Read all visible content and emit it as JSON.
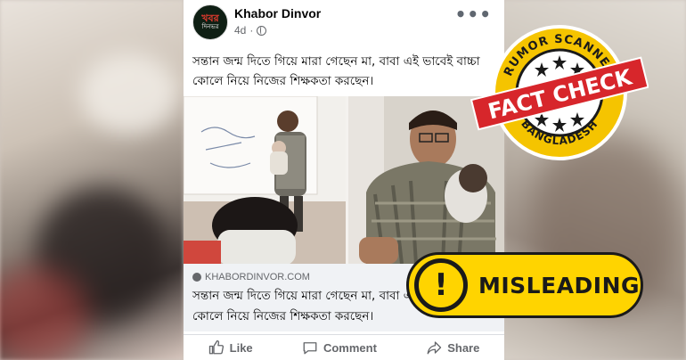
{
  "post": {
    "page_name": "Khabor Dinvor",
    "avatar_line1": "খবর",
    "avatar_line2": "দিনভর",
    "time": "4d",
    "more": "•••",
    "caption": "সন্তান জন্ম দিতে গিয়ে মারা গেছেন মা, বাবা এই ভাবেই বাচ্চা কোলে নিয়ে নিজের শিক্ষকতা করছেন।",
    "link_domain": "KHABORDINVOR.COM",
    "link_title": "সন্তান জন্ম দিতে গিয়ে মারা গেছেন মা, বাবা এই ভাবেই বাচ্চা কোলে নিয়ে নিজের শিক্ষকতা করছেন।",
    "actions": {
      "like": "Like",
      "comment": "Comment",
      "share": "Share"
    }
  },
  "seal": {
    "top_text": "RUMOR SCANNER",
    "center_text": "FACT CHECK",
    "bottom_text": "BANGLADESH",
    "ribbon_color": "#d7262b",
    "ring_color": "#f5c400"
  },
  "badge": {
    "icon": "!",
    "label": "MISLEADING",
    "color": "#ffd400"
  }
}
